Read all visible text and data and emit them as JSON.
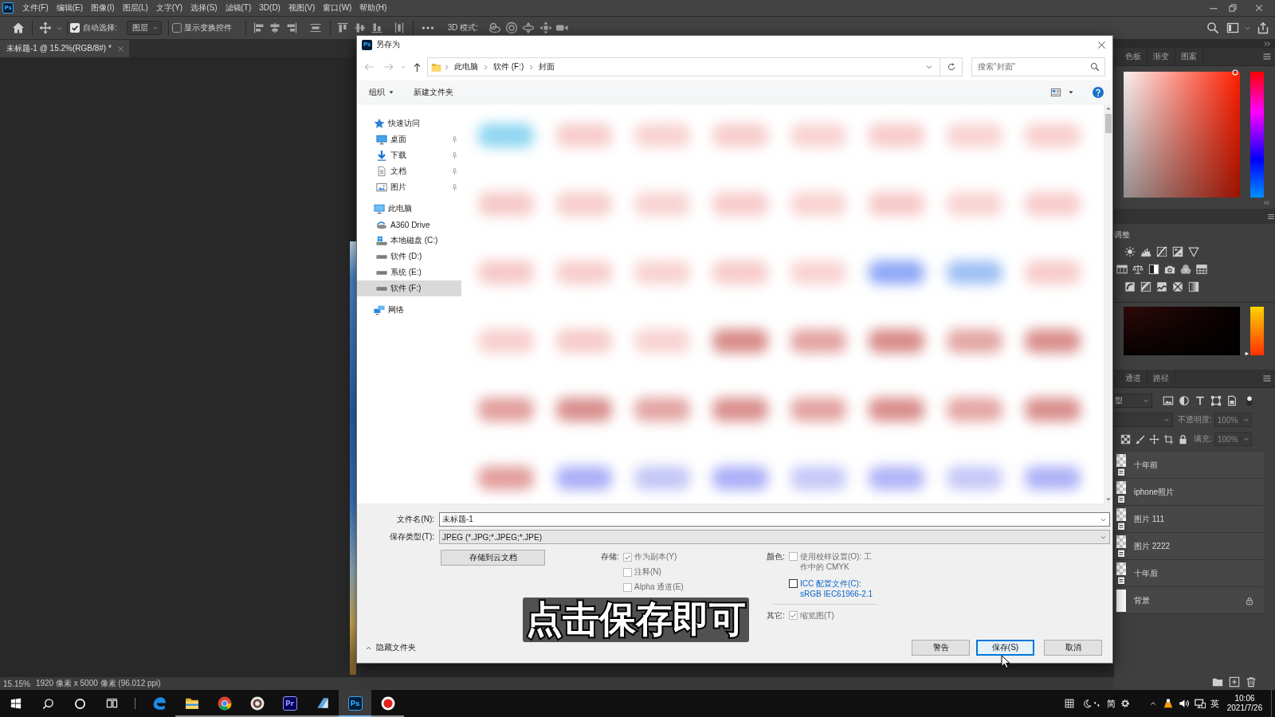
{
  "menubar": {
    "logo": "Ps",
    "items": [
      "文件(F)",
      "编辑(E)",
      "图像(I)",
      "图层(L)",
      "文字(Y)",
      "选择(S)",
      "滤镜(T)",
      "3D(D)",
      "视图(V)",
      "窗口(W)",
      "帮助(H)"
    ]
  },
  "options_bar": {
    "auto_select": {
      "label": "自动选择:",
      "checked": true
    },
    "auto_select_target": "图层",
    "show_transform": {
      "label": "显示变换控件",
      "checked": false
    },
    "mode_3d_label": "3D 模式:"
  },
  "document_tabs": [
    {
      "title": "未标题-1 @ 15.2%(RGB/8#) *",
      "selected": true
    }
  ],
  "dialog": {
    "logo": "Ps",
    "title": "另存为",
    "breadcrumb": [
      "此电脑",
      "软件 (F:)",
      "封面"
    ],
    "search": {
      "placeholder": "搜索\"封面\""
    },
    "toolbar": {
      "organize": "组织",
      "new_folder": "新建文件夹"
    },
    "nav": [
      {
        "label": "快速访问",
        "kind": "quick-access",
        "selected": false,
        "children": [
          {
            "label": "桌面",
            "kind": "desktop",
            "pinned": true,
            "selected": false
          },
          {
            "label": "下载",
            "kind": "downloads",
            "pinned": true,
            "selected": false
          },
          {
            "label": "文档",
            "kind": "documents",
            "pinned": true,
            "selected": false
          },
          {
            "label": "图片",
            "kind": "pictures",
            "pinned": true,
            "selected": false
          }
        ]
      },
      {
        "label": "此电脑",
        "kind": "computer",
        "selected": false,
        "children": [
          {
            "label": "A360 Drive",
            "kind": "cloud",
            "selected": false
          },
          {
            "label": "本地磁盘 (C:)",
            "kind": "system-drive",
            "selected": false
          },
          {
            "label": "软件 (D:)",
            "kind": "drive",
            "selected": false
          },
          {
            "label": "系统 (E:)",
            "kind": "drive",
            "selected": false
          },
          {
            "label": "软件 (F:)",
            "kind": "drive",
            "selected": true
          }
        ]
      },
      {
        "label": "网络",
        "kind": "network",
        "selected": false
      }
    ],
    "thumbnails": [
      {
        "color": "#8fd6f2"
      },
      {
        "color": "#f7cccb"
      },
      {
        "color": "#f8d2d1"
      },
      {
        "color": "#f7cdcc"
      },
      {
        "color": "#f8d3d2"
      },
      {
        "color": "#f7cbca"
      },
      {
        "color": "#f8d3d2"
      },
      {
        "color": "#f8cfce"
      },
      {
        "color": "#f6c9c8"
      },
      {
        "color": "#f7cdcc"
      },
      {
        "color": "#f8d3d2"
      },
      {
        "color": "#f7cbca"
      },
      {
        "color": "#f8d2d1"
      },
      {
        "color": "#f6c9c8"
      },
      {
        "color": "#f8d3d2"
      },
      {
        "color": "#f7cbca"
      },
      {
        "color": "#f6c9c8"
      },
      {
        "color": "#f7cdcc"
      },
      {
        "color": "#f8d2d1"
      },
      {
        "color": "#f7cbca"
      },
      {
        "color": "#f8d3d2"
      },
      {
        "color": "#8fa8f7"
      },
      {
        "color": "#9ec0f4"
      },
      {
        "color": "#f7cbca"
      },
      {
        "color": "#f7cfce"
      },
      {
        "color": "#f6cbca"
      },
      {
        "color": "#f8d3d2"
      },
      {
        "color": "#d88c8a"
      },
      {
        "color": "#e3a4a2"
      },
      {
        "color": "#d88c8a"
      },
      {
        "color": "#e3a6a4"
      },
      {
        "color": "#d98e8c"
      },
      {
        "color": "#e29f9d"
      },
      {
        "color": "#d98f8d"
      },
      {
        "color": "#e3a5a3"
      },
      {
        "color": "#da908e"
      },
      {
        "color": "#e3a3a1"
      },
      {
        "color": "#d98e8c"
      },
      {
        "color": "#e4a6a4"
      },
      {
        "color": "#d98f8d"
      },
      {
        "color": "#e29f9d"
      },
      {
        "color": "#abaff7"
      },
      {
        "color": "#c4c6f6"
      },
      {
        "color": "#abaff7"
      },
      {
        "color": "#c6c8f7"
      },
      {
        "color": "#b0b4f7"
      },
      {
        "color": "#c6c8f7"
      },
      {
        "color": "#aeb2f7"
      }
    ],
    "form": {
      "file_name": {
        "label": "文件名(N):",
        "value": "未标题-1"
      },
      "file_type": {
        "label": "保存类型(T):",
        "value": "JPEG (*.JPG;*.JPEG;*.JPE)"
      },
      "cloud_button": "存储到云文档",
      "groups": [
        {
          "label": "存储:",
          "options": [
            {
              "label": "作为副本(Y)",
              "kind": "plain",
              "checked": true,
              "disabled": true
            },
            {
              "label": "注释(N)",
              "kind": "plain",
              "checked": false,
              "disabled": true
            },
            {
              "label": "Alpha 通道(E)",
              "kind": "plain",
              "checked": false,
              "disabled": true
            }
          ]
        },
        {
          "label": "颜色:",
          "options": [
            {
              "label": "使用校样设置(O): 工作中的 CMYK",
              "kind": "plain",
              "checked": false,
              "disabled": true
            },
            {
              "label": "ICC 配置文件(C):",
              "detail": "sRGB IEC61966-2.1",
              "kind": "link",
              "checked": false,
              "disabled": false
            }
          ]
        },
        {
          "label": "其它:",
          "options": [
            {
              "label": "缩览图(T)",
              "kind": "plain",
              "checked": true,
              "disabled": true
            }
          ]
        }
      ]
    },
    "footer": {
      "hide_folders": "隐藏文件夹",
      "buttons": [
        {
          "label": "警告",
          "kind": "normal"
        },
        {
          "label": "保存(S)",
          "kind": "default"
        },
        {
          "label": "取消",
          "kind": "normal"
        }
      ]
    }
  },
  "caption": "点击保存即可",
  "panels": {
    "color_tabs": [
      {
        "label": "色板",
        "selected": false
      },
      {
        "label": "渐变",
        "selected": false
      },
      {
        "label": "图案",
        "selected": false
      }
    ],
    "adjustments_title": "调整",
    "color_ramp": {
      "level": 0.03
    },
    "layer_tabs": [
      {
        "label": "通道",
        "selected": false
      },
      {
        "label": "路径",
        "selected": false
      }
    ],
    "layer_filter": "型",
    "opacity": {
      "label": "不透明度:",
      "value": "100%",
      "disabled": true
    },
    "fill": {
      "label": "填充:",
      "value": "100%",
      "disabled": true
    },
    "layers": [
      {
        "name": "十年前",
        "kind": "smart-object",
        "locked": false,
        "selected": false
      },
      {
        "name": "iphone照片",
        "kind": "smart-object",
        "locked": false,
        "selected": false
      },
      {
        "name": "图片 111",
        "kind": "smart-object",
        "locked": false,
        "selected": false
      },
      {
        "name": "图片 2222",
        "kind": "smart-object",
        "locked": false,
        "selected": false
      },
      {
        "name": "十年后",
        "kind": "smart-object",
        "locked": false,
        "selected": false
      },
      {
        "name": "背景",
        "kind": "background",
        "locked": true,
        "selected": false
      }
    ]
  },
  "status_bar": {
    "zoom": "15.15%",
    "document_info": "1920 像素 x 5000 像素 (96.012 ppi)"
  },
  "taskbar": {
    "apps": [
      {
        "kind": "edge",
        "running": false,
        "active": false
      },
      {
        "kind": "explorer",
        "running": true,
        "active": false
      },
      {
        "kind": "chrome",
        "running": true,
        "active": false
      },
      {
        "kind": "generic",
        "running": true,
        "active": false
      },
      {
        "kind": "premiere",
        "label": "Pr",
        "running": true,
        "active": false
      },
      {
        "kind": "notes",
        "running": true,
        "active": false
      },
      {
        "kind": "photoshop",
        "label": "Ps",
        "running": true,
        "active": true
      },
      {
        "kind": "recorder",
        "running": true,
        "active": false
      }
    ],
    "tray": {
      "ime_mode": "简",
      "language": "英",
      "time": "10:06",
      "date": "2021/7/26"
    }
  }
}
